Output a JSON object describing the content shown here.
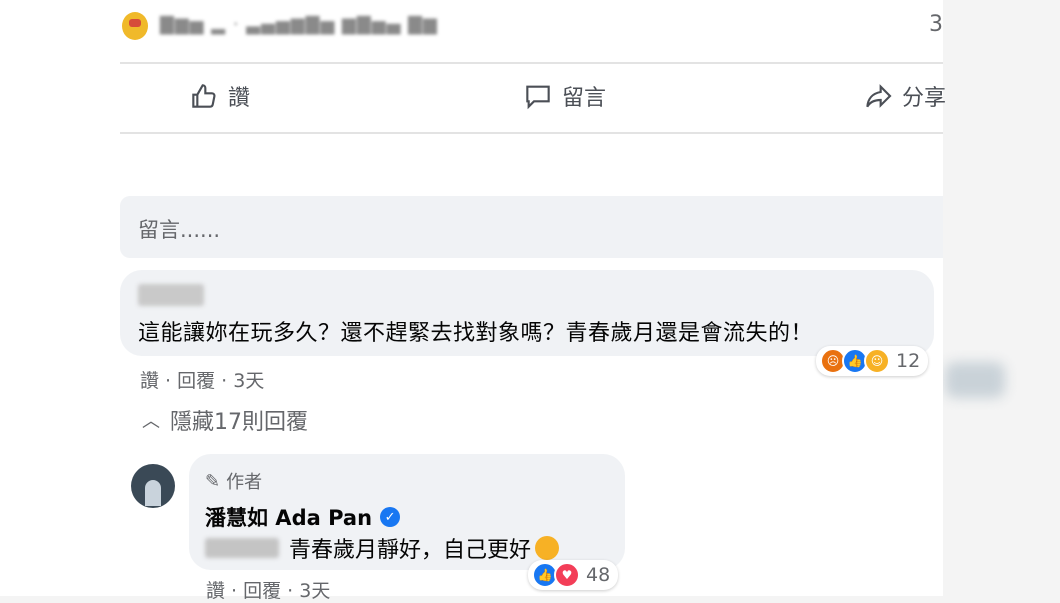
{
  "post": {
    "poster_line": "​",
    "count_right": "3",
    "actions": {
      "like": "讚",
      "comment": "留言",
      "share": "分享"
    }
  },
  "comment_input": {
    "placeholder": "留言......"
  },
  "comment1": {
    "text": "這能讓妳在玩多久？還不趕緊去找對象嗎？青春歲月還是會流失的！",
    "reaction_count": "12",
    "meta": "讚 · 回覆 · 3天",
    "reactions": [
      "angry",
      "like",
      "haha"
    ]
  },
  "hide_replies": "隱藏17則回覆",
  "comment2": {
    "author_tag": "作者",
    "name": "潘慧如 Ada Pan",
    "text": "青春歲月靜好，自己更好",
    "reaction_count": "48",
    "meta": "讚 · 回覆 · 3天",
    "reactions": [
      "like",
      "love"
    ]
  },
  "colors": {
    "accent": "#1877f2",
    "bubble": "#f0f2f5",
    "muted_text": "#65676b"
  }
}
